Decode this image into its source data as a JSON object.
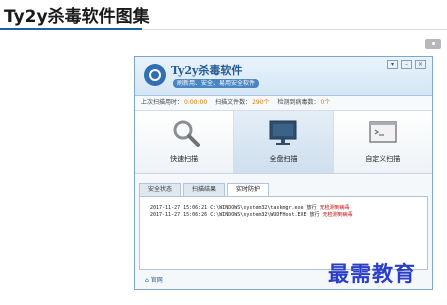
{
  "page": {
    "title": "Ty2y杀毒软件图集"
  },
  "app": {
    "name": "Ty2y杀毒软件",
    "subtitle": "刷新用、安全、易用安全软件",
    "window_controls": [
      "▾",
      "–",
      "×"
    ]
  },
  "status": {
    "last_scan_label": "上次扫描用时：",
    "last_scan_value": "0:00:00",
    "scanned_label": "扫描文件数：",
    "scanned_value": "290个",
    "threats_label": "检测到病毒数：",
    "threats_value": "0个"
  },
  "actions": [
    {
      "label": "快速扫描",
      "icon": "magnifier-icon"
    },
    {
      "label": "全盘扫描",
      "icon": "monitor-icon"
    },
    {
      "label": "自定义扫描",
      "icon": "terminal-window-icon"
    }
  ],
  "tabs": [
    "安全状态",
    "扫描结果",
    "实时防护"
  ],
  "log": [
    {
      "text": "2017-11-27 15:06:21 C:\\WINDOWS\\system32\\taskmgr.exe 放行",
      "result": "无检测到病毒"
    },
    {
      "text": "2017-11-27 15:06:26 C:\\WINDOWS\\system32\\WUDFHost.EXE 放行",
      "result": "无检测到病毒"
    }
  ],
  "footer": {
    "home_label": "官网"
  },
  "watermark": "最需教育",
  "colors": {
    "accent": "#1a5fa8",
    "watermark": "#2a3ec7"
  }
}
